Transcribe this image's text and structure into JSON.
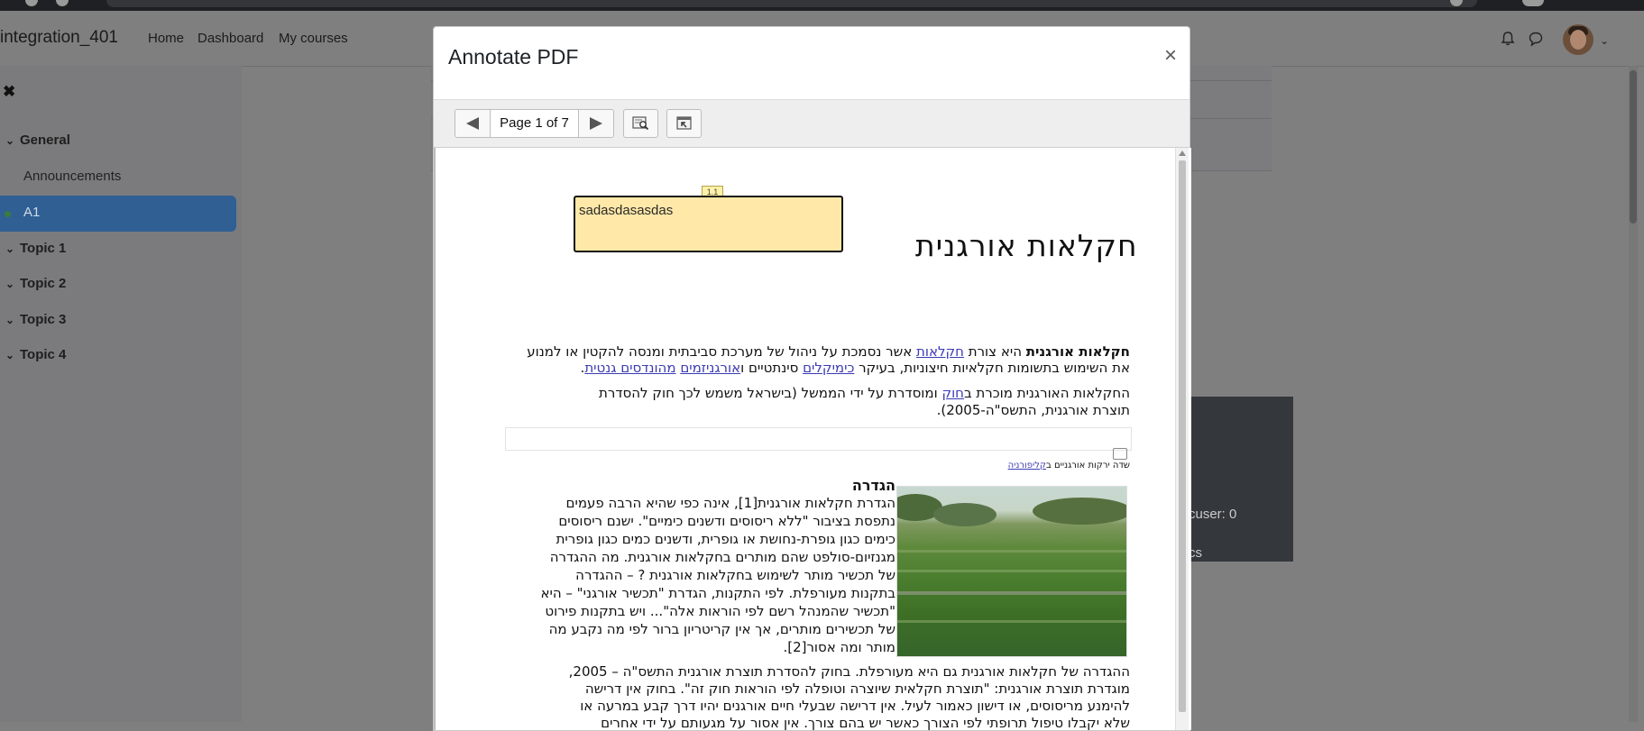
{
  "navbar": {
    "site_name": "integration_401",
    "links": [
      "Home",
      "Dashboard",
      "My courses"
    ]
  },
  "drawer": {
    "close_glyph": "✖",
    "sections": [
      {
        "label": "General"
      },
      {
        "label": "Topic 1"
      },
      {
        "label": "Topic 2"
      },
      {
        "label": "Topic 3"
      },
      {
        "label": "Topic 4"
      }
    ],
    "items": [
      "Announcements",
      "A1"
    ]
  },
  "background": {
    "user_text": "cuser: 0",
    "extra_text": "cs"
  },
  "modal": {
    "title": "Annotate PDF",
    "close_glyph": "×",
    "page_label": "Page 1 of 7"
  },
  "annotation": {
    "label": "1.1",
    "text": "sadasdasasdas"
  },
  "pdf": {
    "title": "חקלאות אורגנית",
    "p1_line1_bold": "חקלאות אורגנית",
    "p1_line1_a": " היא צורת ",
    "p1_line1_link": "חקלאות",
    "p1_line1_b": " אשר נסמכת על ניהול של מערכת סביבתית ומנסה להקטין או למנוע",
    "p1_line2_a": "את השימוש בתשומות חקלאיות חיצוניות, בעיקר ",
    "p1_line2_link1": "כימיקלים",
    "p1_line2_b": " סינתטיים ו",
    "p1_line2_link2": "אורגניזמים",
    "p1_line2_c": " ",
    "p1_line2_link3": "מהונדסים גנטית",
    "p1_line2_d": ".",
    "p2_line1_a": "החקלאות האורגנית מוכרת ב",
    "p2_line1_link": "חוק",
    "p2_line1_b": " ומוסדרת על ידי הממשל (בישראל משמש לכך חוק להסדרת",
    "p2_line2": "תוצרת אורגנית, התשס\"ה-2005).",
    "caption_a": "שדה ירקות אורגניים ב",
    "caption_link": "קליפורניה",
    "heading": "הגדרה",
    "def_lines": [
      "הגדרת חקלאות אורגנית[1], אינה כפי שהיא הרבה פעמים",
      "נתפסת בציבור \"ללא ריסוסים ודשנים כימיים\". ישנם ריסוסים",
      "כימים כגון גופרת-נחושת או גופרית, ודשנים כמים כגון גופרית",
      "מגנזיום-סולפט שהם מותרים בחקלאות אורגנית. מה ההגדרה",
      "של תכשיר מותר לשימוש בחקלאות אורגנית ? – ההגדרה",
      "בתקנות מעורפלת. לפי התקנות, הגדרת \"תכשיר אורגני\" – היא",
      "\"תכשיר שהמנהל רשם לפי הוראות אלה\"... ויש בתקנות פירוט",
      "של תכשירים מותרים, אך אין קריטריון ברור לפי מה נקבע מה",
      "מותר ומה אסור[2]."
    ],
    "p3_lines": [
      "ההגדרה של חקלאות אורגנית גם היא מעורפלת. בחוק להסדרת תוצרת אורגנית התשס\"ה – 2005,",
      "מוגדרת תוצרת אורגנית: \"תוצרת חקלאית שיוצרה וטופלה לפי הוראות חוק זה\". בחוק אין דרישה",
      "להימנע מריסוסים, או דישון כאמור לעיל. אין דרישה שבעלי חיים אורגנים יהיו דרך קבע במרעה או",
      "שלא יקבלו טיפול תרופתי לפי הצורך כאשר יש בהם צורך. אין אסור על מגעותם על ידי אחרים"
    ]
  },
  "colors": {
    "overlay": "#7f7f80",
    "active_item": "#2f5f93",
    "annotation_fill": "#ffe8a8",
    "link": "#3b3bb3"
  }
}
